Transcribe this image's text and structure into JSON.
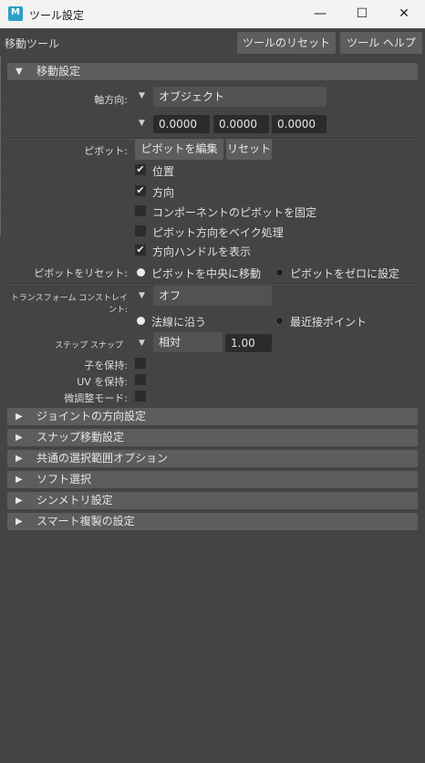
{
  "window": {
    "title": "ツール設定",
    "app_icon": "M",
    "minimize": "—",
    "maximize": "☐",
    "close": "✕"
  },
  "toolbar": {
    "tool_name": "移動ツール",
    "reset_label": "ツールのリセット",
    "help_label": "ツール ヘルプ"
  },
  "move_settings": {
    "header": "移動設定",
    "axis_label": "軸方向:",
    "axis_value": "オブジェクト",
    "axis_x": "0.0000",
    "axis_y": "0.0000",
    "axis_z": "0.0000",
    "pivot_label": "ピボット:",
    "edit_pivot": "ピボットを編集",
    "reset": "リセット",
    "checks": [
      {
        "label": "位置",
        "checked": true
      },
      {
        "label": "方向",
        "checked": true
      },
      {
        "label": "コンポーネントのピボットを固定",
        "checked": false
      },
      {
        "label": "ピボット方向をベイク処理",
        "checked": false
      },
      {
        "label": "方向ハンドルを表示",
        "checked": true
      }
    ],
    "reset_pivot_label": "ピボットをリセット:",
    "reset_opt1": "ピボットを中央に移動",
    "reset_opt2": "ピボットをゼロに設定",
    "constraint_label": "トランスフォーム コンストレイント:",
    "constraint_value": "オフ",
    "normal_opt": "法線に沿う",
    "nearest_opt": "最近接ポイント",
    "step_label": "ステップ スナップ",
    "step_mode": "相対",
    "step_value": "1.00",
    "preserve_children": "子を保持:",
    "preserve_uv": "UV を保持:",
    "fine_mode": "微調整モード:"
  },
  "sections": [
    "ジョイントの方向設定",
    "スナップ移動設定",
    "共通の選択範囲オプション",
    "ソフト選択",
    "シンメトリ設定",
    "スマート複製の設定"
  ],
  "colors": {
    "accent": "#2aa1c9",
    "panel": "#444444",
    "header": "#5d5d5d"
  }
}
